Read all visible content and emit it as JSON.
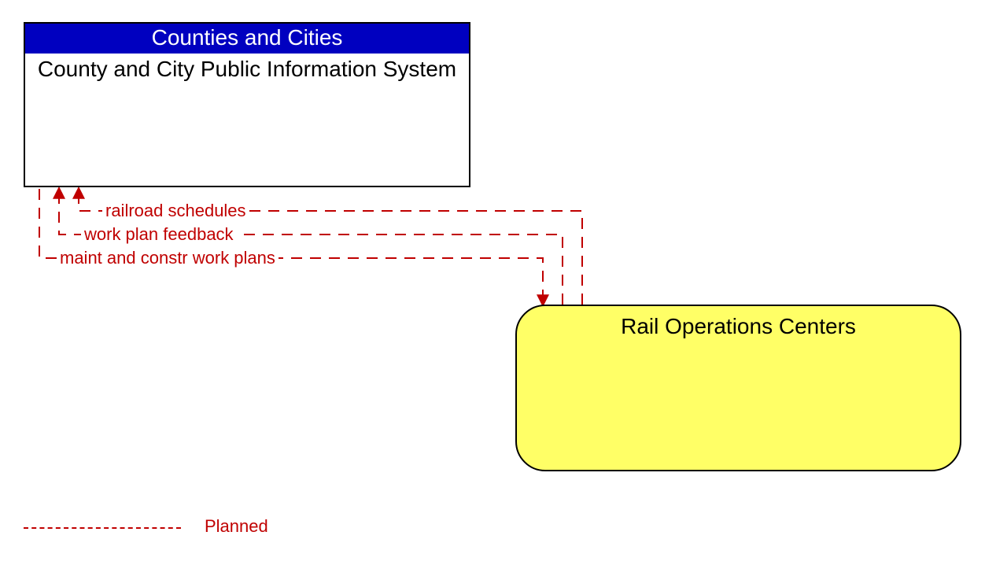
{
  "boxes": {
    "county": {
      "header": "Counties and Cities",
      "body": "County and City Public Information System"
    },
    "rail": {
      "title": "Rail Operations Centers"
    }
  },
  "flows": {
    "f1": "railroad schedules",
    "f2": "work plan feedback",
    "f3": "maint and constr work plans"
  },
  "legend": {
    "label": "Planned"
  },
  "colors": {
    "header_bg": "#0000c0",
    "rail_bg": "#ffff66",
    "flow": "#c00000"
  }
}
